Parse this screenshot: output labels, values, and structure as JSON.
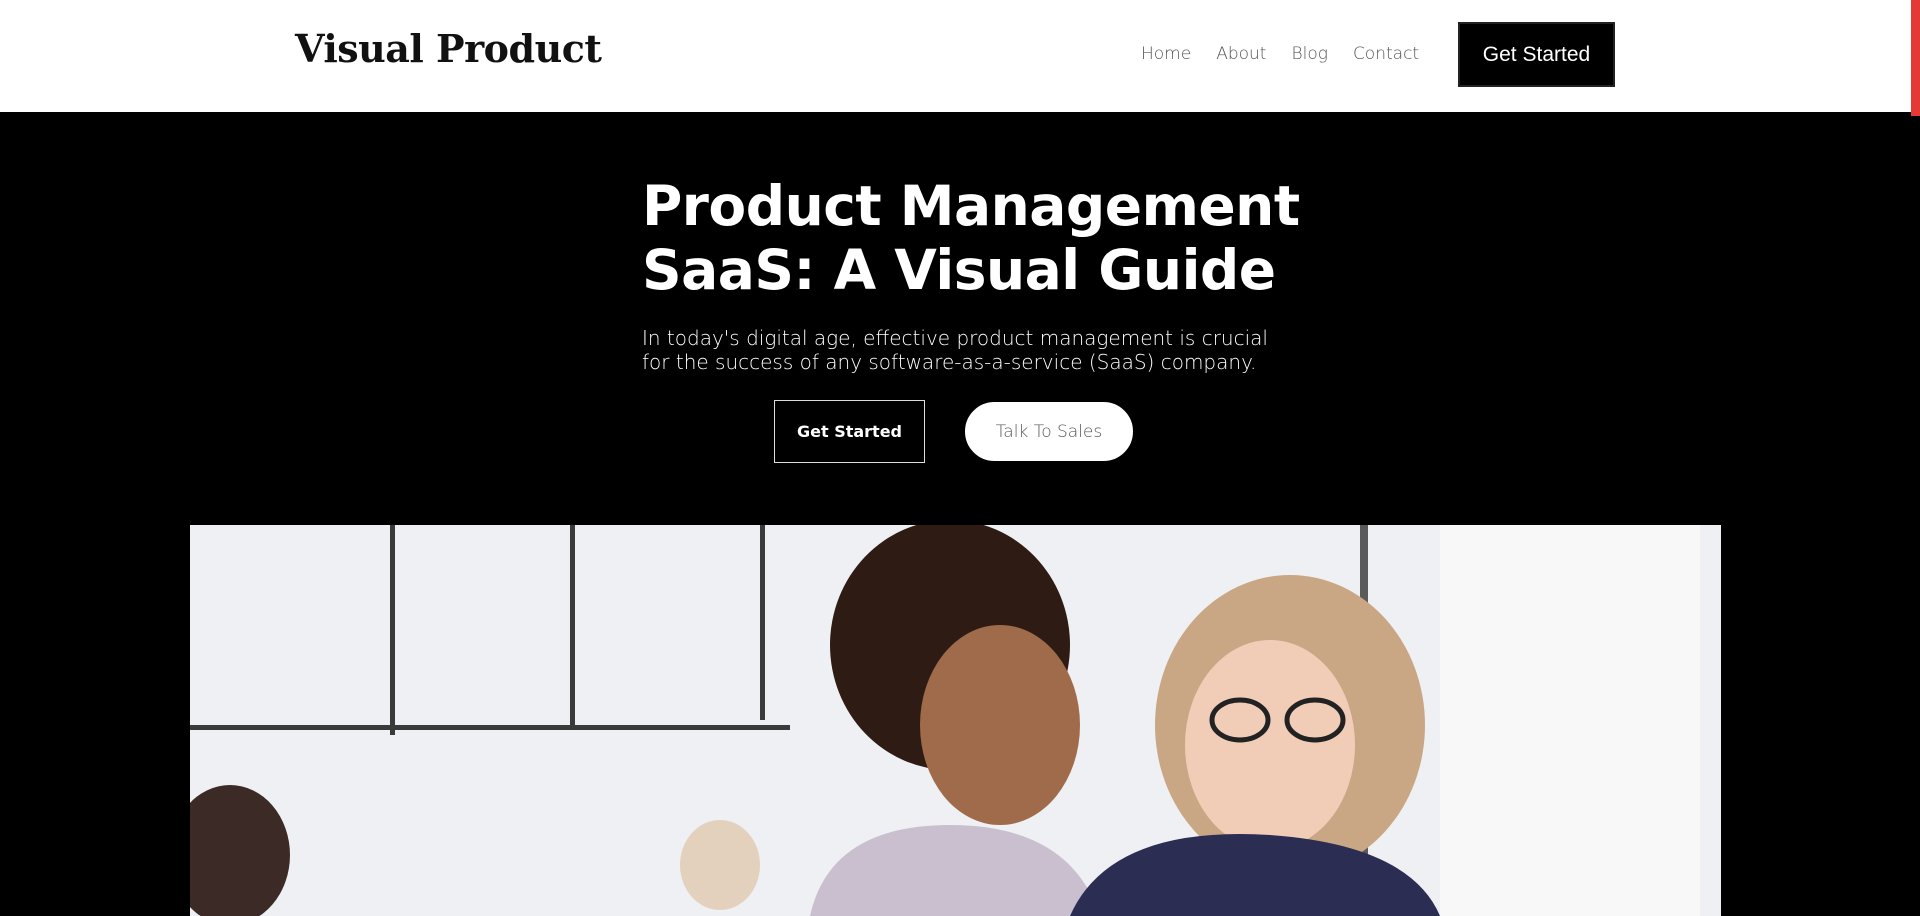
{
  "header": {
    "logo": "Visual Product",
    "nav": [
      "Home",
      "About",
      "Blog",
      "Contact"
    ],
    "cta_label": "Get Started"
  },
  "hero": {
    "title": "Product Management SaaS: A Visual Guide",
    "subtitle": "In today's digital age, effective product management is crucial for the success of any software-as-a-service (SaaS) company.",
    "primary_button": "Get Started",
    "secondary_button": "Talk To Sales"
  },
  "colors": {
    "header_bg": "#ffffff",
    "hero_bg": "#000000",
    "accent": "#e53935"
  }
}
